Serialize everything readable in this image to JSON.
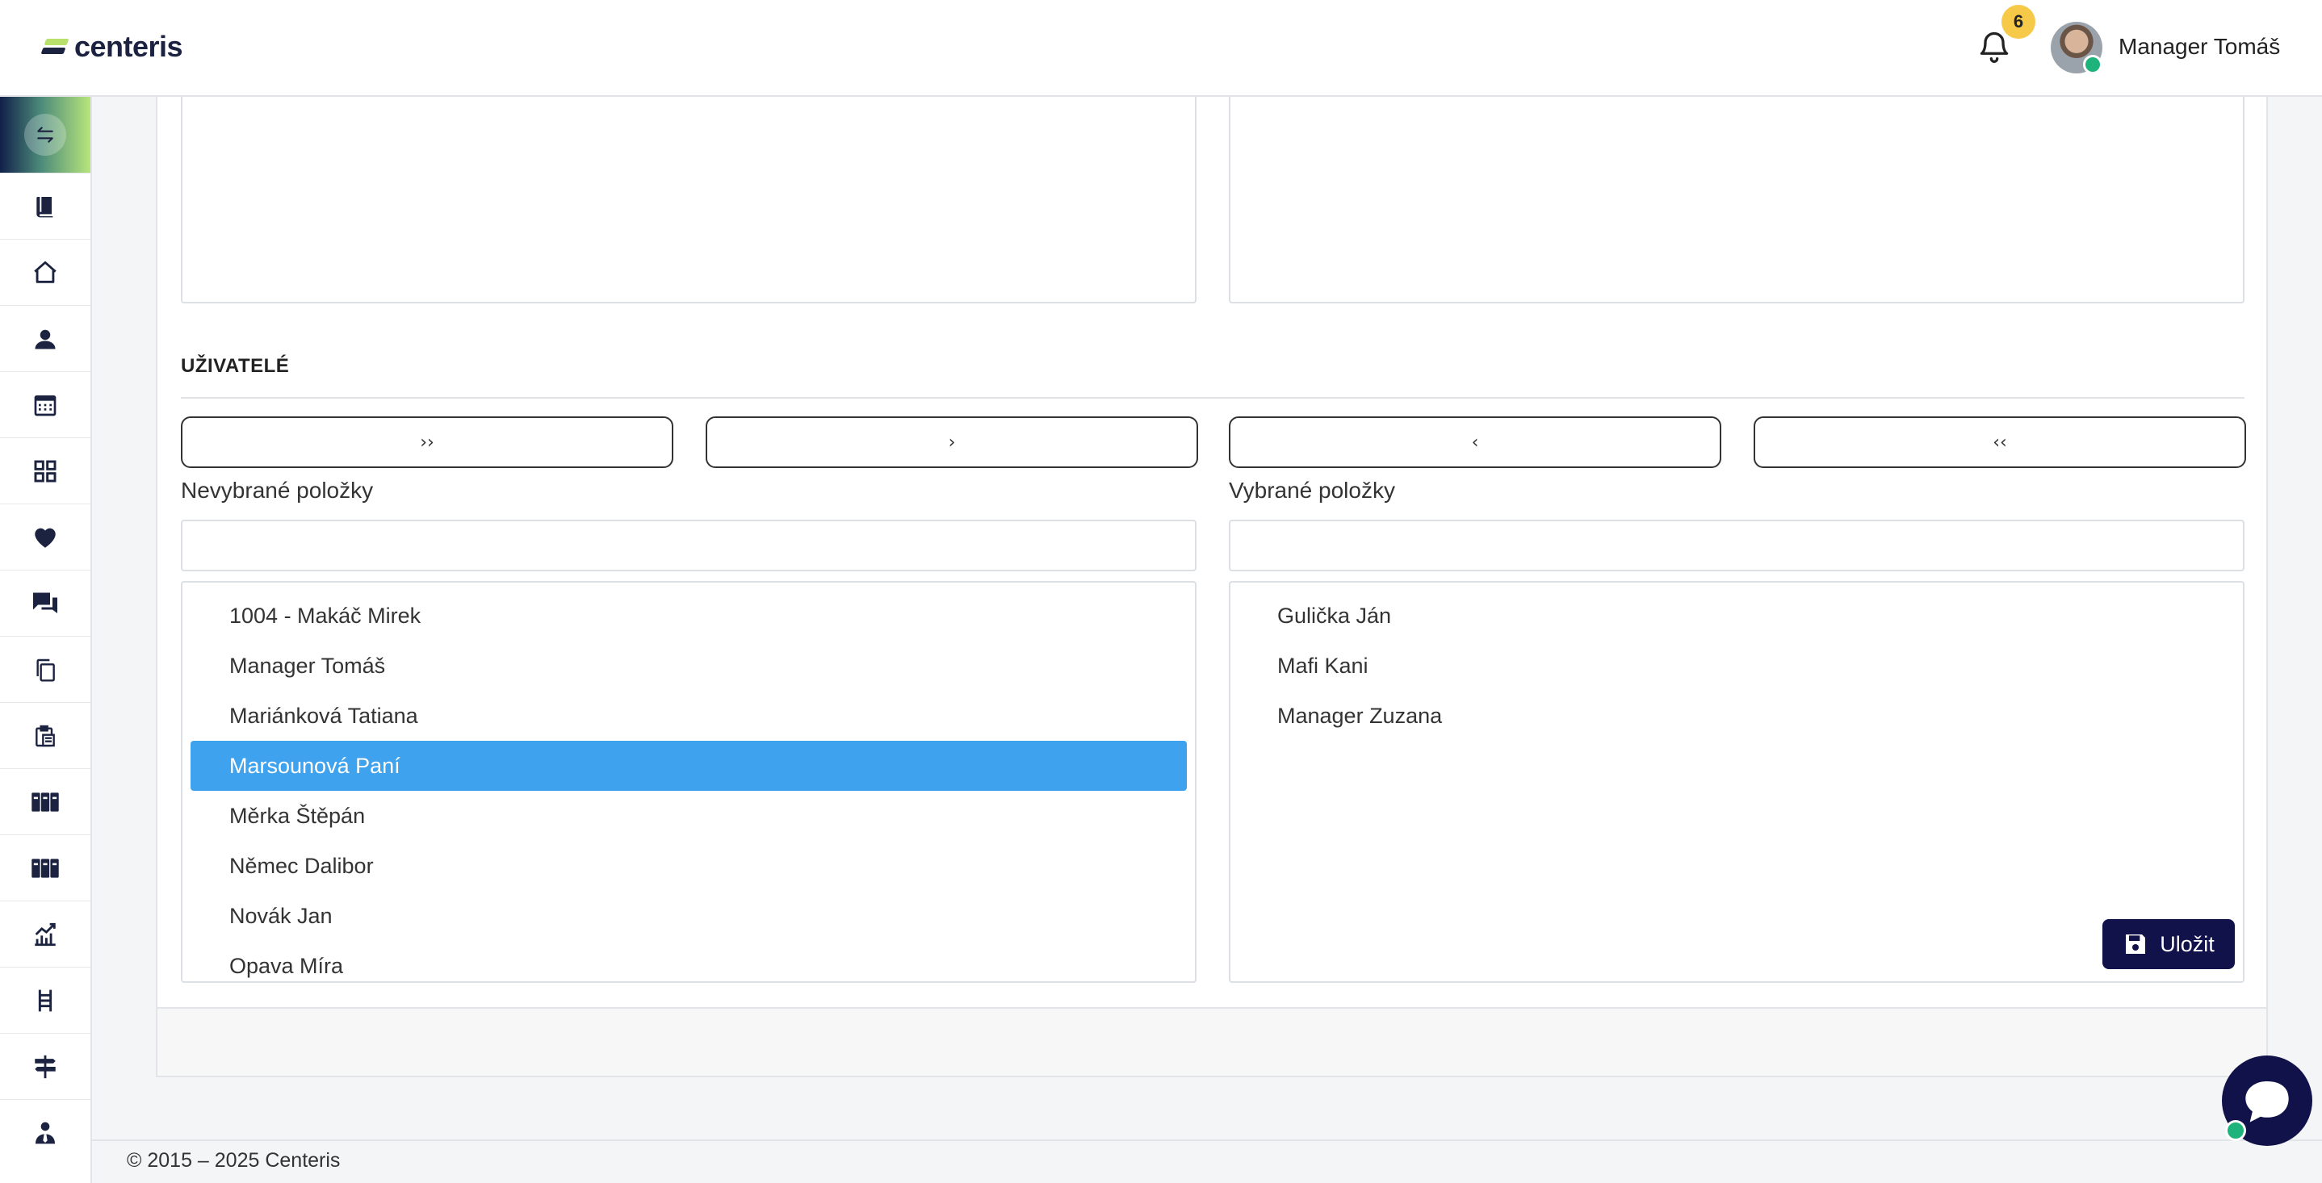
{
  "header": {
    "logo_text": "centeris",
    "notifications_count": "6",
    "user_name": "Manager Tomáš"
  },
  "sidebar": {
    "items": [
      {
        "icon": "book-icon"
      },
      {
        "icon": "home-icon"
      },
      {
        "icon": "user-icon"
      },
      {
        "icon": "calendar-icon"
      },
      {
        "icon": "grid-icon"
      },
      {
        "icon": "heart-icon"
      },
      {
        "icon": "chat-icon"
      },
      {
        "icon": "copy-icon"
      },
      {
        "icon": "clipboard-icon"
      },
      {
        "icon": "archive-icon"
      },
      {
        "icon": "archive-icon"
      },
      {
        "icon": "chart-icon"
      },
      {
        "icon": "ladder-icon"
      },
      {
        "icon": "signpost-icon"
      },
      {
        "icon": "manager-icon"
      }
    ]
  },
  "users_section": {
    "title": "UŽIVATELÉ",
    "buttons": {
      "move_all_right": "››",
      "move_right": "›",
      "move_left": "‹",
      "move_all_left": "‹‹"
    },
    "unselected_label": "Nevybrané položky",
    "selected_label": "Vybrané položky",
    "unselected_items": [
      "1004 - Makáč Mirek",
      "Manager Tomáš",
      "Mariánková Tatiana",
      "Marsounová Paní",
      "Měrka Štěpán",
      "Němec Dalibor",
      "Novák Jan",
      "Opava Míra"
    ],
    "highlighted_item": "Marsounová Paní",
    "selected_items": [
      "Gulička Ján",
      "Mafi Kani",
      "Manager Zuzana"
    ]
  },
  "actions": {
    "save_label": "Uložit"
  },
  "footer": {
    "copyright": "© 2015 – 2025 Centeris"
  },
  "colors": {
    "accent_navy": "#12124a",
    "selection_blue": "#3ea2ee",
    "badge_yellow": "#f7c948",
    "online_green": "#1db37a"
  }
}
